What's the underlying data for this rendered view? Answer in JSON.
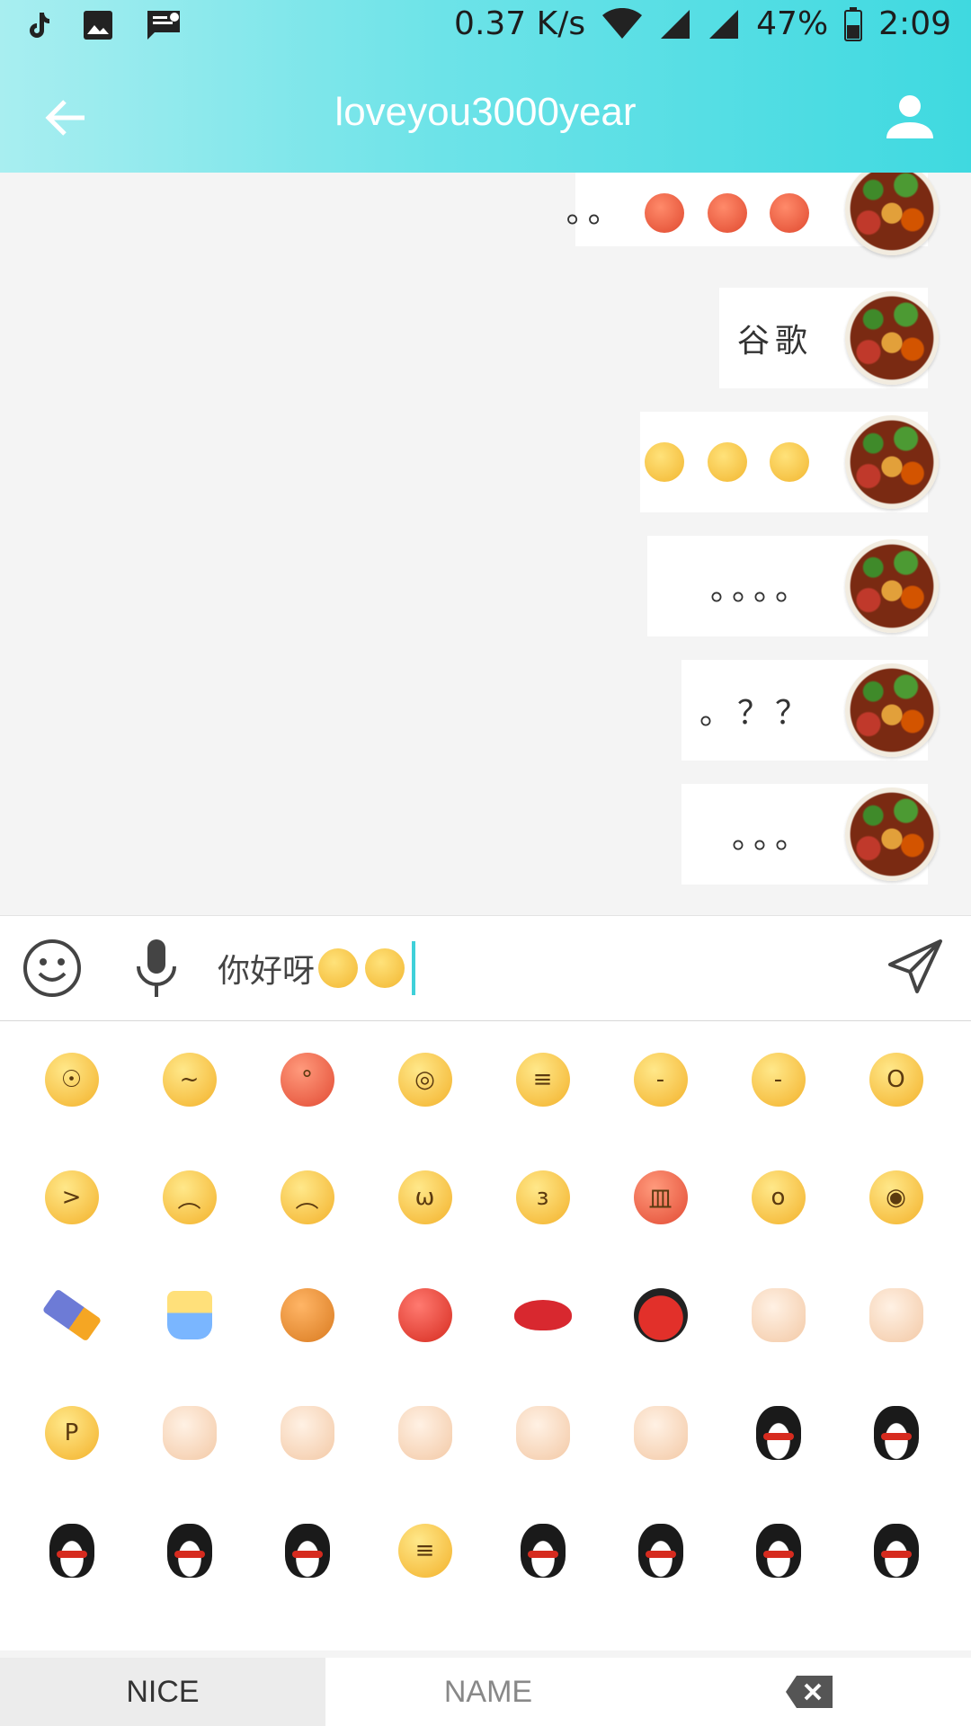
{
  "status_bar": {
    "net_speed": "0.37 K/s",
    "battery": "47%",
    "time": "2:09",
    "icons": [
      "tiktok-icon",
      "image-icon",
      "message-icon",
      "wifi-icon",
      "signal-icon",
      "signal-icon",
      "battery-icon"
    ]
  },
  "header": {
    "title": "loveyou3000year",
    "back_icon": "arrow-left-icon",
    "profile_icon": "person-icon"
  },
  "messages": [
    {
      "text": "。。",
      "emoji": [
        "red-sweat-face",
        "red-sweat-face",
        "red-sweat-face"
      ]
    },
    {
      "text": "谷歌",
      "emoji": []
    },
    {
      "text": "",
      "emoji": [
        "shocked-face",
        "shocked-face",
        "shocked-face"
      ]
    },
    {
      "text": "。。。。",
      "emoji": []
    },
    {
      "text": "。？？",
      "emoji": []
    },
    {
      "text": "。。。",
      "emoji": []
    }
  ],
  "input": {
    "value": "你好呀",
    "value_emoji": [
      "grin-face",
      "grin-face"
    ],
    "emoji_button_icon": "smile-icon",
    "mic_icon": "mic-icon",
    "send_icon": "send-icon"
  },
  "emoji_grid": [
    "shocked",
    "worried",
    "red-sweat",
    "cold-sweat",
    "grin",
    "shy",
    "smirk",
    "yawn",
    "angry-hug",
    "sad",
    "frown",
    "sneer",
    "kiss",
    "fury",
    "startled",
    "teary",
    "cleaver",
    "beer",
    "basketball",
    "ping-pong",
    "lips",
    "ladybug",
    "handshake",
    "strong-arm",
    "tongue",
    "fist",
    "point-up",
    "rock-on",
    "peace",
    "ok-hand",
    "penguin",
    "penguin",
    "penguin",
    "penguin",
    "penguin",
    "grin",
    "penguin",
    "penguin",
    "penguin",
    "penguin"
  ],
  "tabs": {
    "nice": "NICE",
    "name": "NAME",
    "backspace_icon": "backspace-icon"
  },
  "colors": {
    "header_start": "#a8eef0",
    "header_end": "#3fd9e0",
    "accent": "#3fd0d9"
  }
}
